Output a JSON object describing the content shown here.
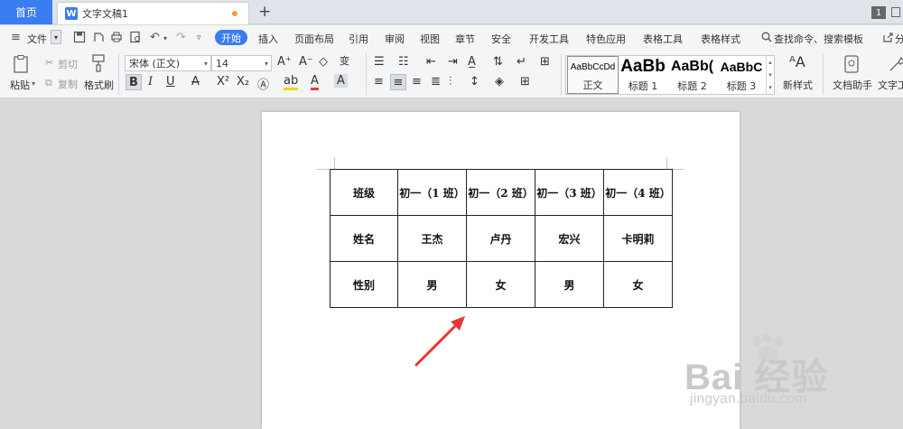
{
  "tabs": {
    "home": "首页",
    "doc_icon": "W",
    "doc_title": "文字文稿1",
    "add": "+",
    "window_count": "1"
  },
  "menu": {
    "hamburger": "≡",
    "file": "文件",
    "items": [
      "开始",
      "插入",
      "页面布局",
      "引用",
      "审阅",
      "视图",
      "章节",
      "安全",
      "开发工具",
      "特色应用",
      "表格工具",
      "表格样式"
    ],
    "search": "查找命令、搜索模板",
    "share": "分"
  },
  "ribbon": {
    "paste": "粘贴",
    "cut": "剪切",
    "copy": "复制",
    "format_painter": "格式刷",
    "font_name": "宋体 (正文)",
    "font_size": "14",
    "styles": [
      {
        "preview": "AaBbCcDd",
        "label": "正文"
      },
      {
        "preview": "AaBb",
        "label": "标题 1"
      },
      {
        "preview": "AaBb(",
        "label": "标题 2"
      },
      {
        "preview": "AaBbC",
        "label": "标题 3"
      }
    ],
    "new_style": "新样式",
    "doc_helper": "文档助手",
    "text_tool": "文字工"
  },
  "table": {
    "rows": [
      [
        "班级",
        "初一（1 班）",
        "初一（2 班）",
        "初一（3 班）",
        "初一（4 班）"
      ],
      [
        "姓名",
        "王杰",
        "卢丹",
        "宏兴",
        "卡明莉"
      ],
      [
        "性别",
        "男",
        "女",
        "男",
        "女"
      ]
    ]
  },
  "watermark": {
    "main": "Bai 经验",
    "sub": "jingyan.baidu.com"
  },
  "colors": {
    "accent": "#3b7cf0",
    "arrow": "#e53935",
    "modified_dot": "#f29b4a"
  }
}
